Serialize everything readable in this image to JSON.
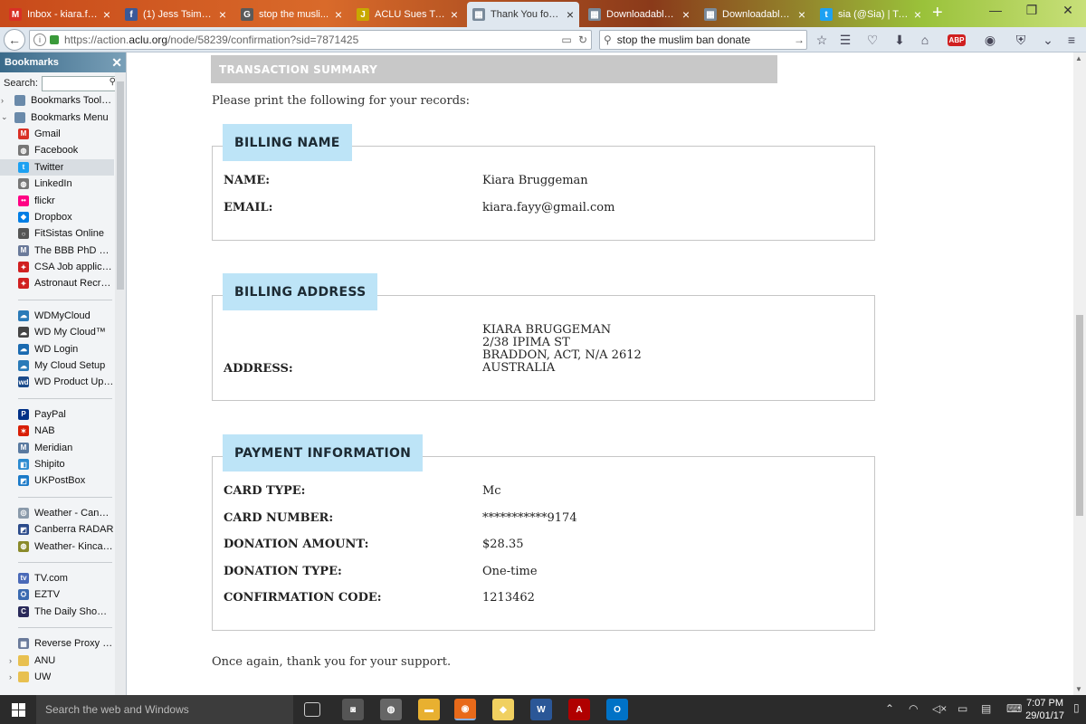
{
  "tabs": [
    {
      "label": "Inbox - kiara.fa...",
      "icon": "gmail-icon",
      "color": "#d93025",
      "glyph": "M"
    },
    {
      "label": "(1) Jess Tsimeris",
      "icon": "facebook-icon",
      "color": "#3b5998",
      "glyph": "f"
    },
    {
      "label": "stop the musli...",
      "icon": "google-icon",
      "color": "#5a5a5a",
      "glyph": "G"
    },
    {
      "label": "ACLU Sues Tru...",
      "icon": "aclu-icon",
      "color": "#c8a800",
      "glyph": "J"
    },
    {
      "label": "Thank You for ...",
      "icon": "page-icon",
      "color": "#7a8a9a",
      "glyph": "▦"
    },
    {
      "label": "Downloadable ...",
      "icon": "page-icon",
      "color": "#7a8a9a",
      "glyph": "▦"
    },
    {
      "label": "Downloadable ...",
      "icon": "page-icon",
      "color": "#7a8a9a",
      "glyph": "▦"
    },
    {
      "label": "sia (@Sia) | Twi...",
      "icon": "twitter-icon",
      "color": "#1da1f2",
      "glyph": "t"
    }
  ],
  "nav": {
    "url_prefix": "https://action.",
    "url_domain": "aclu.org",
    "url_path": "/node/58239/confirmation?sid=7871425",
    "search_value": "stop the muslim ban donate"
  },
  "sidebar": {
    "title": "Bookmarks",
    "search_label": "Search:",
    "items": [
      {
        "label": "Bookmarks Toolbar",
        "type": "folder",
        "color": "#6a8aaa"
      },
      {
        "label": "Bookmarks Menu",
        "type": "folder-open",
        "color": "#6a8aaa"
      },
      {
        "label": "Gmail",
        "color": "#d93025",
        "glyph": "M"
      },
      {
        "label": "Facebook",
        "color": "#777777",
        "glyph": "◍"
      },
      {
        "label": "Twitter",
        "color": "#1da1f2",
        "glyph": "t"
      },
      {
        "label": "LinkedIn",
        "color": "#777777",
        "glyph": "◍"
      },
      {
        "label": "flickr",
        "color": "#ff0084",
        "glyph": "••"
      },
      {
        "label": "Dropbox",
        "color": "#007ee5",
        "glyph": "◆"
      },
      {
        "label": "FitSistas Online",
        "color": "#555555",
        "glyph": "○"
      },
      {
        "label": "The BBB PhD – B...",
        "color": "#6a7a9a",
        "glyph": "M"
      },
      {
        "label": "CSA Job applicati...",
        "color": "#d02020",
        "glyph": "✦"
      },
      {
        "label": "Astronaut Recruit...",
        "color": "#d02020",
        "glyph": "✦"
      },
      {
        "sep": true
      },
      {
        "label": "WDMyCloud",
        "color": "#2a7ab8",
        "glyph": "☁"
      },
      {
        "label": "WD My Cloud™",
        "color": "#444444",
        "glyph": "☁"
      },
      {
        "label": "WD Login",
        "color": "#1a6ab0",
        "glyph": "☁"
      },
      {
        "label": "My Cloud Setup",
        "color": "#2a7ab8",
        "glyph": "☁"
      },
      {
        "label": "WD Product Upd...",
        "color": "#1a4a8a",
        "glyph": "wd"
      },
      {
        "sep": true
      },
      {
        "label": "PayPal",
        "color": "#003087",
        "glyph": "P"
      },
      {
        "label": "NAB",
        "color": "#d81e05",
        "glyph": "✶"
      },
      {
        "label": "Meridian",
        "color": "#5a7aa0",
        "glyph": "M"
      },
      {
        "label": "Shipito",
        "color": "#2a8ad0",
        "glyph": "◧"
      },
      {
        "label": "UKPostBox",
        "color": "#1a7ac8",
        "glyph": "◩"
      },
      {
        "sep": true
      },
      {
        "label": "Weather - Canbe...",
        "color": "#8a9aaa",
        "glyph": "◎"
      },
      {
        "label": "Canberra RADAR",
        "color": "#2a4a8a",
        "glyph": "◩"
      },
      {
        "label": "Weather- Kincard...",
        "color": "#8a8a2a",
        "glyph": "◍"
      },
      {
        "sep": true
      },
      {
        "label": "TV.com",
        "color": "#4a6ab8",
        "glyph": "tv"
      },
      {
        "label": "EZTV",
        "color": "#3a6ab0",
        "glyph": "⛭"
      },
      {
        "label": "The Daily Show w...",
        "color": "#2a2a5a",
        "glyph": "C"
      },
      {
        "sep": true
      },
      {
        "label": "Reverse Proxy - A...",
        "color": "#6a7a9a",
        "glyph": "▦"
      },
      {
        "label": "ANU",
        "type": "folder-closed",
        "color": "#e8c050"
      },
      {
        "label": "UW",
        "type": "folder-closed",
        "color": "#e8c050"
      }
    ]
  },
  "page": {
    "summary_title": "TRANSACTION SUMMARY",
    "print_note": "Please print the following for your records:",
    "billing_name": {
      "heading": "BILLING NAME",
      "rows": [
        {
          "label": "NAME:",
          "value": "Kiara Bruggeman"
        },
        {
          "label": "EMAIL:",
          "value": "kiara.fayy@gmail.com"
        }
      ]
    },
    "billing_address": {
      "heading": "BILLING ADDRESS",
      "label": "ADDRESS:",
      "lines": [
        "KIARA BRUGGEMAN",
        "2/38 IPIMA ST",
        "BRADDON, ACT, N/A 2612",
        "AUSTRALIA"
      ]
    },
    "payment": {
      "heading": "PAYMENT INFORMATION",
      "rows": [
        {
          "label": "CARD TYPE:",
          "value": "Mc"
        },
        {
          "label": "CARD NUMBER:",
          "value": "***********9174"
        },
        {
          "label": "DONATION AMOUNT:",
          "value": "$28.35"
        },
        {
          "label": "DONATION TYPE:",
          "value": "One-time"
        },
        {
          "label": "CONFIRMATION CODE:",
          "value": "1213462"
        }
      ]
    },
    "thanks": "Once again, thank you for your support."
  },
  "taskbar": {
    "search_placeholder": "Search the web and Windows",
    "time": "7:07 PM",
    "date": "29/01/17"
  }
}
